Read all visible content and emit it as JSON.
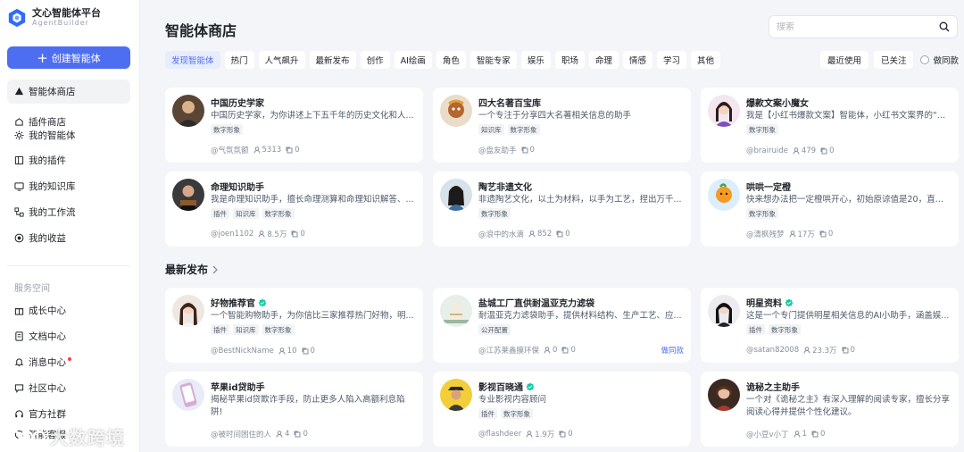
{
  "app": {
    "title": "文心智能体平台",
    "subtitle": "AgentBuilder"
  },
  "sidebar": {
    "create_label": "创建智能体",
    "items": [
      {
        "label": "智能体商店",
        "icon": "store-icon"
      },
      {
        "label": "插件商店",
        "icon": "plugin-store-icon"
      },
      {
        "label": "我的智能体",
        "icon": "agent-icon"
      },
      {
        "label": "我的插件",
        "icon": "plugin-icon"
      },
      {
        "label": "我的知识库",
        "icon": "knowledge-icon"
      },
      {
        "label": "我的工作流",
        "icon": "workflow-icon"
      },
      {
        "label": "我的收益",
        "icon": "earnings-icon"
      }
    ],
    "section_label": "服务空间",
    "service_items": [
      {
        "label": "成长中心",
        "icon": "gift-icon"
      },
      {
        "label": "文档中心",
        "icon": "document-icon"
      },
      {
        "label": "消息中心",
        "icon": "bell-icon"
      },
      {
        "label": "社区中心",
        "icon": "chat-icon"
      },
      {
        "label": "官方社群",
        "icon": "headset-icon"
      },
      {
        "label": "智能客服",
        "icon": "service-icon"
      }
    ]
  },
  "header": {
    "title": "智能体商店",
    "search_placeholder": "搜索"
  },
  "tabs": [
    "发现智能体",
    "热门",
    "人气飙升",
    "最新发布",
    "创作",
    "AI绘画",
    "角色",
    "智能专家",
    "娱乐",
    "职场",
    "命理",
    "情感",
    "学习",
    "其他"
  ],
  "filters": {
    "recent": "最近使用",
    "followed": "已关注",
    "used": "做同款"
  },
  "colors": {
    "accent": "#4e6ef2",
    "verified": "#14c9a6",
    "dot": "#f53f3f"
  },
  "featured": [
    {
      "title": "中国历史学家",
      "desc": "中国历史学家，为你讲述上下五千年的历史文化和人...",
      "tags": [
        "数字形象"
      ],
      "author": "@气氛氛额",
      "users": "5313",
      "copies": "0"
    },
    {
      "title": "四大名著百宝库",
      "desc": "一个专注于分享四大名著相关信息的助手",
      "tags": [
        "知识库",
        "数字形象"
      ],
      "author": "@盘友助手",
      "users": "",
      "copies": "0"
    },
    {
      "title": "爆款文案小魔女",
      "desc": "我是【小红书爆款文案】智能体，小红书文案界的“...",
      "tags": [
        "数字形象"
      ],
      "author": "@brairuide",
      "users": "479",
      "copies": "0"
    },
    {
      "title": "命理知识助手",
      "desc": "我是命理知识助手，擅长命理测算和命理知识解答、...",
      "tags": [
        "插件",
        "知识库",
        "数字形象"
      ],
      "author": "@joen1102",
      "users": "8.5万",
      "copies": "0"
    },
    {
      "title": "陶艺非遗文化",
      "desc": "非遗陶艺文化，以土为材料，以手为工艺，捏出万千...",
      "tags": [
        "数字形象"
      ],
      "author": "@浪中的水滴",
      "users": "852",
      "copies": "0"
    },
    {
      "title": "哄哄一定橙",
      "desc": "快来想办法把一定橙哄开心，初始原谅值是20，直至...",
      "tags": [
        "数字形象"
      ],
      "author": "@清枫残梦",
      "users": "17万",
      "copies": "0"
    }
  ],
  "latest": {
    "title": "最新发布",
    "cards": [
      {
        "title": "好物推荐官",
        "verified": true,
        "desc": "一个智能购物助手，为你信比三家推荐热门好物，明...",
        "tags": [
          "插件",
          "知识库",
          "数字形象"
        ],
        "author": "@BestNickName",
        "users": "10",
        "copies": "0",
        "used": ""
      },
      {
        "title": "盐城工厂直供耐温亚克力滤袋",
        "verified": false,
        "desc": "耐温亚克力滤袋助手，提供材料结构、生产工艺、应...",
        "tags": [
          "公开配置"
        ],
        "author": "@江苏莱鑫膜环保",
        "users": "0",
        "copies": "0",
        "used": "做同款"
      },
      {
        "title": "明星资料",
        "verified": true,
        "desc": "这是一个专门提供明星相关信息的AI小助手，涵盖娱...",
        "tags": [
          "插件",
          "数字形象"
        ],
        "author": "@satan82008",
        "users": "23.3万",
        "copies": "0",
        "used": ""
      },
      {
        "title": "苹果id贷助手",
        "verified": false,
        "desc": "揭秘苹果id贷欺诈手段，防止更多人陷入高额利息陷阱!",
        "tags": [],
        "author": "@被时间困住的人",
        "users": "4",
        "copies": "0",
        "used": ""
      },
      {
        "title": "影视百晓通",
        "verified": true,
        "desc": "专业影视内容顾问",
        "tags": [
          "插件",
          "数字形象"
        ],
        "author": "@flashdeer",
        "users": "1.9万",
        "copies": "0",
        "used": ""
      },
      {
        "title": "诡秘之主助手",
        "verified": false,
        "desc": "一个对《诡秘之主》有深入理解的阅读专家，擅长分享阅读心得并提供个性化建议。",
        "tags": [],
        "author": "@小豆v小丁",
        "users": "1",
        "copies": "0",
        "used": ""
      }
    ]
  },
  "watermark": "大数跨境"
}
